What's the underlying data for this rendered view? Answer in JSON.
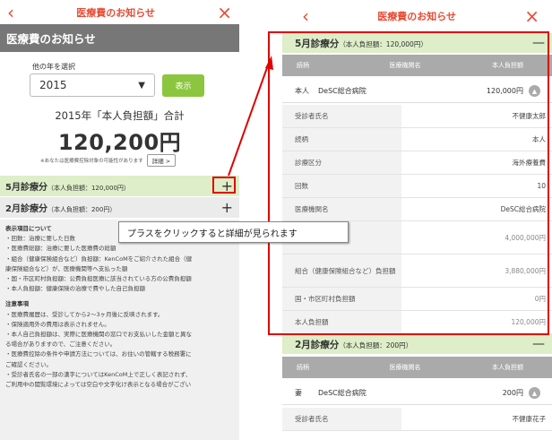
{
  "left": {
    "nav": {
      "back": "‹",
      "title": "医療費のお知らせ",
      "close": "×"
    },
    "header": "医療費のお知らせ",
    "year_label": "他の年を選択",
    "year_value": "2015",
    "show_button": "表示",
    "total_caption": "2015年「本人負担額」合計",
    "total_amount": "120,200円",
    "note": "※あなたは医療費控除対象の可能性があります",
    "detail_button": "詳細 >",
    "months": [
      {
        "label": "5月診療分",
        "sub": "（本人負担額：120,000円）",
        "toggle": "+"
      },
      {
        "label": "2月診療分",
        "sub": "（本人負担額：200円）",
        "toggle": "+"
      }
    ],
    "info": {
      "heading1": "表示項目について",
      "items1": [
        "・回数：治療に要した日数",
        "・医療費総額：治療に要した医療費の総額",
        "・組合（健康保険組合など）負担額：KenCoMをご紹介された組合（健",
        "康保険組合など）が、医療機関等へ支払った額",
        "・国・市区町村負担額：公費負担医療に該当されている方の公費負担額",
        "・本人負担額：健康保険の治療で費やした自己負担額"
      ],
      "heading2": "注意事項",
      "items2": [
        "・医療費履歴は、受診してから2～3ヶ月後に反映されます。",
        "・保険適用外の費用は表示されません。",
        "・本人自己負担額は、実際に医療機関の窓口でお支払いした金額と異な",
        "る場合がありますので、ご注意ください。",
        "・医療費控除の条件や申請方法については、お住いの管轄する税務署に",
        "ご確認ください。",
        "・受診者氏名の一部の漢字についてはKenCoM上で正しく表記されず、",
        "ご利用中の閲覧環境によっては空白や文字化け表示となる場合がござい"
      ]
    }
  },
  "callout": "プラスをクリックすると詳細が見られます",
  "right": {
    "nav": {
      "back": "‹",
      "title": "医療費のお知らせ",
      "close": "×"
    },
    "table_headers": [
      "続柄",
      "医療機関名",
      "本人負担額"
    ],
    "may": {
      "label": "5月診療分",
      "sub": "（本人負担額：120,000円）",
      "toggle": "—",
      "summary": {
        "who": "本人",
        "hospital": "DeSC総合病院",
        "amount": "120,000円"
      },
      "details": [
        {
          "k": "受診者氏名",
          "v": "不健康太郎"
        },
        {
          "k": "続柄",
          "v": "本人"
        },
        {
          "k": "診療区分",
          "v": "海外療養費"
        },
        {
          "k": "回数",
          "v": "10"
        },
        {
          "k": "医療機関名",
          "v": "DeSC総合病院"
        },
        {
          "k": "",
          "v": "4,000,000円"
        },
        {
          "k": "組合（健康保険組合など）負担額",
          "v": "3,880,000円"
        },
        {
          "k": "国・市区町村負担額",
          "v": "0円"
        },
        {
          "k": "本人負担額",
          "v": "120,000円"
        }
      ]
    },
    "feb": {
      "label": "2月診療分",
      "sub": "（本人負担額：200円）",
      "toggle": "—",
      "summary": {
        "who": "妻",
        "hospital": "DeSC総合病院",
        "amount": "200円"
      },
      "details": [
        {
          "k": "受診者氏名",
          "v": "不健康花子"
        }
      ]
    }
  },
  "colors": {
    "accent": "#e94b35",
    "green_btn": "#8cc63f",
    "highlight_red": "#e00000",
    "month_bg": "#ddeec8"
  }
}
